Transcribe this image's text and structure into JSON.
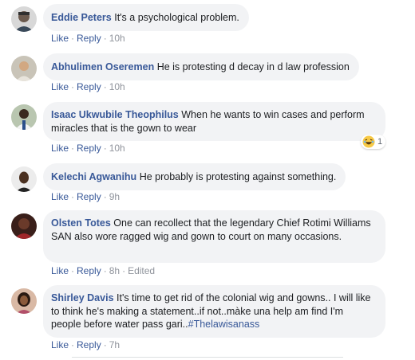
{
  "comments": [
    {
      "author": "Eddie Peters",
      "text": "It's a psychological problem.",
      "like": "Like",
      "reply": "Reply",
      "time": "10h"
    },
    {
      "author": "Abhulimen Oseremen",
      "text": "He is protesting d decay in d law profession",
      "like": "Like",
      "reply": "Reply",
      "time": "10h"
    },
    {
      "author": "Isaac Ukwubile Theophilus",
      "text": "When he wants to win cases and perform miracles that is the gown to wear",
      "like": "Like",
      "reply": "Reply",
      "time": "10h",
      "reaction_icon": "laughing-emoji-icon",
      "reaction_count": "1"
    },
    {
      "author": "Kelechi Agwanihu",
      "text": "He probably is protesting against something.",
      "like": "Like",
      "reply": "Reply",
      "time": "9h"
    },
    {
      "author": "Olsten Totes",
      "text": "One can recollect that the legendary Chief Rotimi Williams SAN also wore ragged wig and gown to court on many occasions.",
      "like": "Like",
      "reply": "Reply",
      "time": "8h",
      "edited": "Edited"
    },
    {
      "author": "Shirley Davis",
      "text": "It's time to get rid of the colonial wig and gowns.. I will like to think he's making a statement..if not..màke una help am find I'm people before water pass gari..",
      "hashtag": "#Thelawisanass",
      "like": "Like",
      "reply": "Reply",
      "time": "7h"
    }
  ],
  "colors": {
    "author": "#385898",
    "bubble": "#f2f3f5",
    "meta": "#90949c"
  }
}
